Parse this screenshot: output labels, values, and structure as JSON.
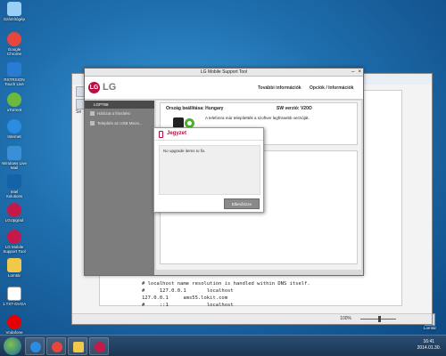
{
  "desktop": {
    "icons": [
      {
        "label": "Számítógép",
        "icon": "computer-icon",
        "color": "#9ad0f5"
      },
      {
        "label": "Google Chrome",
        "icon": "chrome-icon",
        "color": "#e8463c"
      },
      {
        "label": "RSTRSION Touch Live",
        "icon": "app-icon",
        "color": "#2a7bd3"
      },
      {
        "label": "uTorrent",
        "icon": "utorrent-icon",
        "color": "#6cb93c"
      },
      {
        "label": "Internet",
        "icon": "internet-icon",
        "color": "#2a8de0"
      },
      {
        "label": "Windows Live Mail",
        "icon": "mail-icon",
        "color": "#3b8fd6"
      },
      {
        "label": "Intel Solutions",
        "icon": "intel-icon",
        "color": "#1463a8"
      },
      {
        "label": "LGUpgrad",
        "icon": "lg-icon",
        "color": "#c41a4a"
      },
      {
        "label": "LG Mobile Support Tool",
        "icon": "lg-icon",
        "color": "#c41a4a"
      },
      {
        "label": "Lomtár",
        "icon": "folder-icon",
        "color": "#f0c84a"
      },
      {
        "label": "1.TXT-DVGA",
        "icon": "document-icon",
        "color": "#ffffff"
      },
      {
        "label": "Vodafone Mobile",
        "icon": "vodafone-icon",
        "color": "#e60000"
      }
    ],
    "recycle_bin": "Lomtár"
  },
  "background_window": {
    "side_label": "Sé",
    "code_lines": [
      "# localhost name resolution is handled within DNS itself.",
      "#     127.0.0.1       localhost",
      "127.0.0.1     ams55.lokit.com",
      "#     ::1             localhost"
    ],
    "zoom": "100%"
  },
  "lg_window": {
    "title": "LG Mobile Support Tool",
    "logo_text": "LG",
    "menu_more_info": "További információk",
    "menu_options": "Opciók / Információk",
    "sidebar_header": "LGP768",
    "sidebar_items": [
      "Hálózat a frissítési",
      "Telepítés az USB Meza..."
    ],
    "country_label": "Ország beállítása: Hungary",
    "sw_version": "SW verzió: V20O",
    "message": "A telefonra már telepítették a szoftver legfrissebb verzióját."
  },
  "dialog": {
    "title": "Jegyzet",
    "body": "No upgrade items to fix.",
    "button": "Ellenőrizze"
  },
  "taskbar": {
    "time": "16:41",
    "date": "2014.01.30."
  },
  "colors": {
    "lg_brand": "#b51140",
    "desktop_blue": "#1f6fae"
  }
}
